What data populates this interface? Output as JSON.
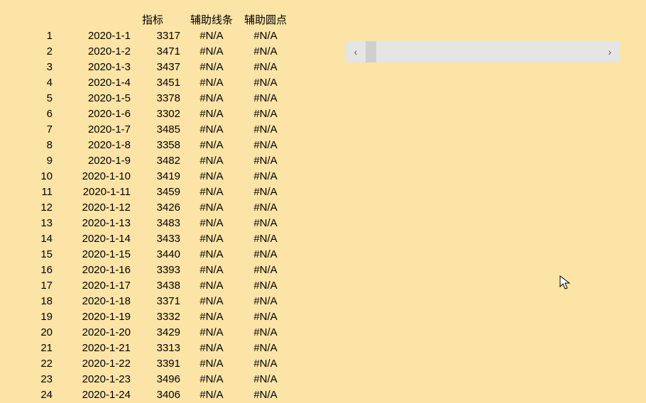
{
  "headers": {
    "idx": "",
    "date": "",
    "metric": "指标",
    "line": "辅助线条",
    "dot": "辅助圆点"
  },
  "rows": [
    {
      "idx": "1",
      "date": "2020-1-1",
      "metric": "3317",
      "line": "#N/A",
      "dot": "#N/A"
    },
    {
      "idx": "2",
      "date": "2020-1-2",
      "metric": "3471",
      "line": "#N/A",
      "dot": "#N/A"
    },
    {
      "idx": "3",
      "date": "2020-1-3",
      "metric": "3437",
      "line": "#N/A",
      "dot": "#N/A"
    },
    {
      "idx": "4",
      "date": "2020-1-4",
      "metric": "3451",
      "line": "#N/A",
      "dot": "#N/A"
    },
    {
      "idx": "5",
      "date": "2020-1-5",
      "metric": "3378",
      "line": "#N/A",
      "dot": "#N/A"
    },
    {
      "idx": "6",
      "date": "2020-1-6",
      "metric": "3302",
      "line": "#N/A",
      "dot": "#N/A"
    },
    {
      "idx": "7",
      "date": "2020-1-7",
      "metric": "3485",
      "line": "#N/A",
      "dot": "#N/A"
    },
    {
      "idx": "8",
      "date": "2020-1-8",
      "metric": "3358",
      "line": "#N/A",
      "dot": "#N/A"
    },
    {
      "idx": "9",
      "date": "2020-1-9",
      "metric": "3482",
      "line": "#N/A",
      "dot": "#N/A"
    },
    {
      "idx": "10",
      "date": "2020-1-10",
      "metric": "3419",
      "line": "#N/A",
      "dot": "#N/A"
    },
    {
      "idx": "11",
      "date": "2020-1-11",
      "metric": "3459",
      "line": "#N/A",
      "dot": "#N/A"
    },
    {
      "idx": "12",
      "date": "2020-1-12",
      "metric": "3426",
      "line": "#N/A",
      "dot": "#N/A"
    },
    {
      "idx": "13",
      "date": "2020-1-13",
      "metric": "3483",
      "line": "#N/A",
      "dot": "#N/A"
    },
    {
      "idx": "14",
      "date": "2020-1-14",
      "metric": "3433",
      "line": "#N/A",
      "dot": "#N/A"
    },
    {
      "idx": "15",
      "date": "2020-1-15",
      "metric": "3440",
      "line": "#N/A",
      "dot": "#N/A"
    },
    {
      "idx": "16",
      "date": "2020-1-16",
      "metric": "3393",
      "line": "#N/A",
      "dot": "#N/A"
    },
    {
      "idx": "17",
      "date": "2020-1-17",
      "metric": "3438",
      "line": "#N/A",
      "dot": "#N/A"
    },
    {
      "idx": "18",
      "date": "2020-1-18",
      "metric": "3371",
      "line": "#N/A",
      "dot": "#N/A"
    },
    {
      "idx": "19",
      "date": "2020-1-19",
      "metric": "3332",
      "line": "#N/A",
      "dot": "#N/A"
    },
    {
      "idx": "20",
      "date": "2020-1-20",
      "metric": "3429",
      "line": "#N/A",
      "dot": "#N/A"
    },
    {
      "idx": "21",
      "date": "2020-1-21",
      "metric": "3313",
      "line": "#N/A",
      "dot": "#N/A"
    },
    {
      "idx": "22",
      "date": "2020-1-22",
      "metric": "3391",
      "line": "#N/A",
      "dot": "#N/A"
    },
    {
      "idx": "23",
      "date": "2020-1-23",
      "metric": "3496",
      "line": "#N/A",
      "dot": "#N/A"
    },
    {
      "idx": "24",
      "date": "2020-1-24",
      "metric": "3406",
      "line": "#N/A",
      "dot": "#N/A"
    }
  ],
  "scrollbar": {
    "left_glyph": "‹",
    "right_glyph": "›"
  }
}
